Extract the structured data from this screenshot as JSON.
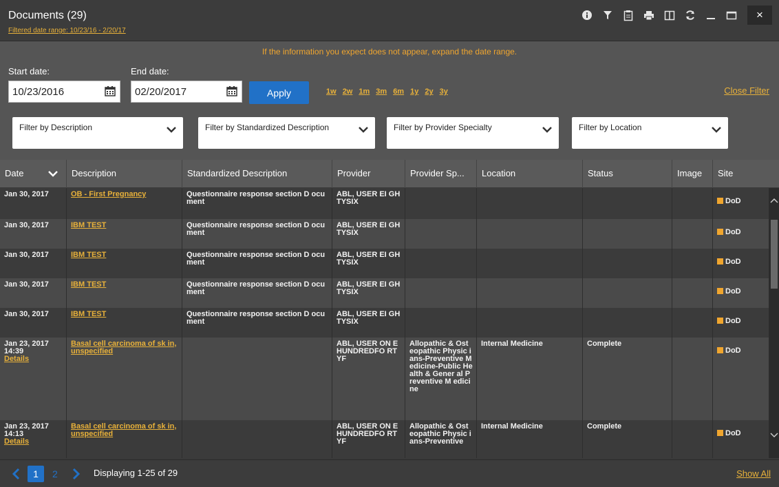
{
  "header": {
    "title": "Documents (29)",
    "subtitle": "Filtered date range: 10/23/16 - 2/20/17",
    "icons": [
      "info-icon",
      "filter-icon",
      "clipboard-icon",
      "print-icon",
      "columns-icon",
      "refresh-icon",
      "minimize-icon",
      "maximize-icon",
      "close-icon"
    ],
    "info_glyph": "ℹ",
    "filter_glyph": "▼",
    "print_glyph": "▣",
    "refresh_glyph": "↻",
    "minimize_glyph": "_",
    "maximize_glyph": "▭",
    "close_glyph": "×"
  },
  "filter": {
    "hint": "If the information you expect does not appear, expand the date range.",
    "start_label": "Start date:",
    "start_value": "10/23/2016",
    "end_label": "End date:",
    "end_value": "02/20/2017",
    "apply_label": "Apply",
    "ranges": [
      "1w",
      "2w",
      "1m",
      "3m",
      "6m",
      "1y",
      "2y",
      "3y"
    ],
    "close_filter": "Close Filter",
    "selects": [
      "Filter by Description",
      "Filter by Standardized Description",
      "Filter by Provider Specialty",
      "Filter by Location"
    ]
  },
  "table": {
    "columns": [
      "Date",
      "Description",
      "Standardized Description",
      "Provider",
      "Provider Sp...",
      "Location",
      "Status",
      "Image",
      "Site"
    ],
    "rows": [
      {
        "date": "Jan 30, 2017",
        "date2": "",
        "details": "",
        "description": "OB - First Pregnancy",
        "std": "Questionnaire response section D ocument",
        "provider": "ABL, USER EI GHTYSIX",
        "specialty": "",
        "location": "",
        "status": "",
        "image": "",
        "site": "DoD"
      },
      {
        "date": "Jan 30, 2017",
        "date2": "",
        "details": "",
        "description": "IBM TEST",
        "std": "Questionnaire response section D ocument",
        "provider": "ABL, USER EI GHTYSIX",
        "specialty": "",
        "location": "",
        "status": "",
        "image": "",
        "site": "DoD"
      },
      {
        "date": "Jan 30, 2017",
        "date2": "",
        "details": "",
        "description": "IBM TEST",
        "std": "Questionnaire response section D ocument",
        "provider": "ABL, USER EI GHTYSIX",
        "specialty": "",
        "location": "",
        "status": "",
        "image": "",
        "site": "DoD"
      },
      {
        "date": "Jan 30, 2017",
        "date2": "",
        "details": "",
        "description": "IBM TEST",
        "std": "Questionnaire response section D ocument",
        "provider": "ABL, USER EI GHTYSIX",
        "specialty": "",
        "location": "",
        "status": "",
        "image": "",
        "site": "DoD"
      },
      {
        "date": "Jan 30, 2017",
        "date2": "",
        "details": "",
        "description": "IBM TEST",
        "std": "Questionnaire response section D ocument",
        "provider": "ABL, USER EI GHTYSIX",
        "specialty": "",
        "location": "",
        "status": "",
        "image": "",
        "site": "DoD"
      },
      {
        "date": "Jan 23, 2017",
        "date2": "14:39",
        "details": "Details",
        "description": "Basal cell carcinoma of sk in, unspecified",
        "std": "",
        "provider": "ABL, USER ON EHUNDREDFO RTYF",
        "specialty": "Allopathic & Ost eopathic Physic ians-Preventive Medicine-Public Health & Gener al Preventive M edicine",
        "location": "Internal Medicine",
        "status": "Complete",
        "image": "",
        "site": "DoD"
      },
      {
        "date": "Jan 23, 2017",
        "date2": "14:13",
        "details": "Details",
        "description": "Basal cell carcinoma of sk in, unspecified",
        "std": "",
        "provider": "ABL, USER ON EHUNDREDFO RTYF",
        "specialty": "Allopathic & Ost eopathic Physic ians-Preventive",
        "location": "Internal Medicine",
        "status": "Complete",
        "image": "",
        "site": "DoD"
      }
    ]
  },
  "footer": {
    "current_page": "1",
    "next_page": "2",
    "displaying": "Displaying 1-25 of 29",
    "show_all": "Show All"
  }
}
